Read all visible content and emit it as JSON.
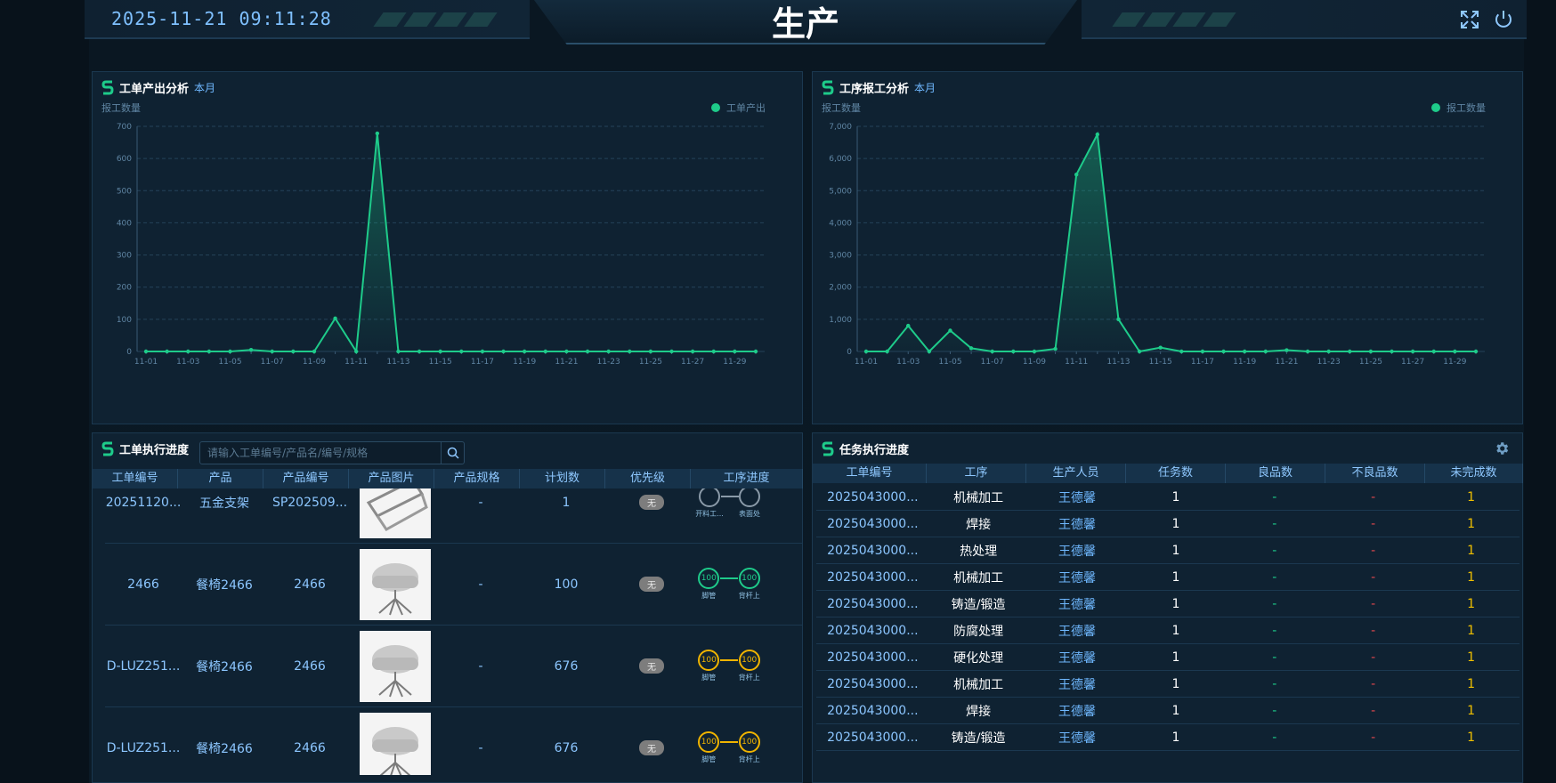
{
  "header": {
    "datetime": "2025-11-21  09:11:28",
    "title": "生产"
  },
  "colors": {
    "accent": "#1ecb8a",
    "blue": "#6fb8ff",
    "red": "#e0484e",
    "yellow": "#f0c000",
    "panel": "#0f2232"
  },
  "icons": {
    "fullscreen": "expand-icon",
    "power": "power-icon",
    "settings": "gear-icon",
    "search": "search-icon"
  },
  "panels": {
    "output": {
      "title": "工单产出分析",
      "sub": "本月"
    },
    "report": {
      "title": "工序报工分析",
      "sub": "本月"
    },
    "workorders": {
      "title": "工单执行进度",
      "search_placeholder": "请输入工单编号/产品名/编号/规格"
    },
    "tasks": {
      "title": "任务执行进度"
    }
  },
  "chart_data": [
    {
      "type": "line",
      "ylabel": "报工数量",
      "ylim": [
        0,
        700
      ],
      "yticks": [
        0,
        100,
        200,
        300,
        400,
        500,
        600,
        700
      ],
      "x": [
        "11-01",
        "11-02",
        "11-03",
        "11-04",
        "11-05",
        "11-06",
        "11-07",
        "11-08",
        "11-09",
        "11-10",
        "11-11",
        "11-12",
        "11-13",
        "11-14",
        "11-15",
        "11-16",
        "11-17",
        "11-18",
        "11-19",
        "11-20",
        "11-21",
        "11-22",
        "11-23",
        "11-24",
        "11-25",
        "11-26",
        "11-27",
        "11-28",
        "11-29",
        "11-30"
      ],
      "xtick_labels": [
        "11-01",
        "11-03",
        "11-05",
        "11-07",
        "11-09",
        "11-11",
        "11-13",
        "11-15",
        "11-17",
        "11-19",
        "11-21",
        "11-23",
        "11-25",
        "11-27",
        "11-29"
      ],
      "series": [
        {
          "name": "工单产出",
          "values": [
            0,
            0,
            0,
            0,
            0,
            5,
            0,
            0,
            0,
            103,
            0,
            678,
            0,
            0,
            0,
            0,
            0,
            0,
            0,
            0,
            0,
            0,
            0,
            0,
            0,
            0,
            0,
            0,
            0,
            0
          ]
        }
      ],
      "legend": "top-right",
      "grid": true
    },
    {
      "type": "line",
      "ylabel": "报工数量",
      "ylim": [
        0,
        7000
      ],
      "yticks": [
        0,
        1000,
        2000,
        3000,
        4000,
        5000,
        6000,
        7000
      ],
      "ytick_labels": [
        "0",
        "1,000",
        "2,000",
        "3,000",
        "4,000",
        "5,000",
        "6,000",
        "7,000"
      ],
      "x": [
        "11-01",
        "11-02",
        "11-03",
        "11-04",
        "11-05",
        "11-06",
        "11-07",
        "11-08",
        "11-09",
        "11-10",
        "11-11",
        "11-12",
        "11-13",
        "11-14",
        "11-15",
        "11-16",
        "11-17",
        "11-18",
        "11-19",
        "11-20",
        "11-21",
        "11-22",
        "11-23",
        "11-24",
        "11-25",
        "11-26",
        "11-27",
        "11-28",
        "11-29",
        "11-30"
      ],
      "xtick_labels": [
        "11-01",
        "11-03",
        "11-05",
        "11-07",
        "11-09",
        "11-11",
        "11-13",
        "11-15",
        "11-17",
        "11-19",
        "11-21",
        "11-23",
        "11-25",
        "11-27",
        "11-29"
      ],
      "series": [
        {
          "name": "报工数量",
          "values": [
            0,
            0,
            800,
            0,
            650,
            100,
            0,
            0,
            0,
            80,
            5500,
            6750,
            1000,
            0,
            120,
            0,
            0,
            0,
            0,
            0,
            40,
            0,
            0,
            0,
            0,
            0,
            0,
            0,
            0,
            0
          ]
        }
      ],
      "legend": "top-right",
      "grid": true
    }
  ],
  "workorders": {
    "columns": [
      "工单编号",
      "产品",
      "产品编号",
      "产品图片",
      "产品规格",
      "计划数",
      "优先级",
      "工序进度"
    ],
    "rows": [
      {
        "code": "20251120...",
        "product": "五金支架",
        "pcode": "SP202509...",
        "spec": "-",
        "plan": "1",
        "priority": "无",
        "steps": [
          {
            "v": "",
            "lbl": "开料工...",
            "color": "#8a9aa8"
          },
          {
            "v": "",
            "lbl": "表面处",
            "color": "#8a9aa8"
          }
        ]
      },
      {
        "code": "2466",
        "product": "餐椅2466",
        "pcode": "2466",
        "spec": "-",
        "plan": "100",
        "priority": "无",
        "steps": [
          {
            "v": "100",
            "lbl": "脚管",
            "color": "#1ecb8a"
          },
          {
            "v": "100",
            "lbl": "背杆上",
            "color": "#1ecb8a"
          }
        ]
      },
      {
        "code": "D-LUZ251...",
        "product": "餐椅2466",
        "pcode": "2466",
        "spec": "-",
        "plan": "676",
        "priority": "无",
        "steps": [
          {
            "v": "100",
            "lbl": "脚管",
            "color": "#f0b400"
          },
          {
            "v": "100",
            "lbl": "背杆上",
            "color": "#f0b400"
          }
        ]
      },
      {
        "code": "D-LUZ251...",
        "product": "餐椅2466",
        "pcode": "2466",
        "spec": "-",
        "plan": "676",
        "priority": "无",
        "steps": [
          {
            "v": "100",
            "lbl": "脚管",
            "color": "#f0b400"
          },
          {
            "v": "100",
            "lbl": "背杆上",
            "color": "#f0b400"
          }
        ]
      }
    ]
  },
  "tasks": {
    "columns": [
      "工单编号",
      "工序",
      "生产人员",
      "任务数",
      "良品数",
      "不良品数",
      "未完成数"
    ],
    "rows": [
      {
        "code": "2025043000...",
        "proc": "机械加工",
        "worker": "王德馨",
        "count": "1",
        "good": "-",
        "bad": "-",
        "left": "1"
      },
      {
        "code": "2025043000...",
        "proc": "焊接",
        "worker": "王德馨",
        "count": "1",
        "good": "-",
        "bad": "-",
        "left": "1"
      },
      {
        "code": "2025043000...",
        "proc": "热处理",
        "worker": "王德馨",
        "count": "1",
        "good": "-",
        "bad": "-",
        "left": "1"
      },
      {
        "code": "2025043000...",
        "proc": "机械加工",
        "worker": "王德馨",
        "count": "1",
        "good": "-",
        "bad": "-",
        "left": "1"
      },
      {
        "code": "2025043000...",
        "proc": "铸造/锻造",
        "worker": "王德馨",
        "count": "1",
        "good": "-",
        "bad": "-",
        "left": "1"
      },
      {
        "code": "2025043000...",
        "proc": "防腐处理",
        "worker": "王德馨",
        "count": "1",
        "good": "-",
        "bad": "-",
        "left": "1"
      },
      {
        "code": "2025043000...",
        "proc": "硬化处理",
        "worker": "王德馨",
        "count": "1",
        "good": "-",
        "bad": "-",
        "left": "1"
      },
      {
        "code": "2025043000...",
        "proc": "机械加工",
        "worker": "王德馨",
        "count": "1",
        "good": "-",
        "bad": "-",
        "left": "1"
      },
      {
        "code": "2025043000...",
        "proc": "焊接",
        "worker": "王德馨",
        "count": "1",
        "good": "-",
        "bad": "-",
        "left": "1"
      },
      {
        "code": "2025043000...",
        "proc": "铸造/锻造",
        "worker": "王德馨",
        "count": "1",
        "good": "-",
        "bad": "-",
        "left": "1"
      }
    ]
  }
}
